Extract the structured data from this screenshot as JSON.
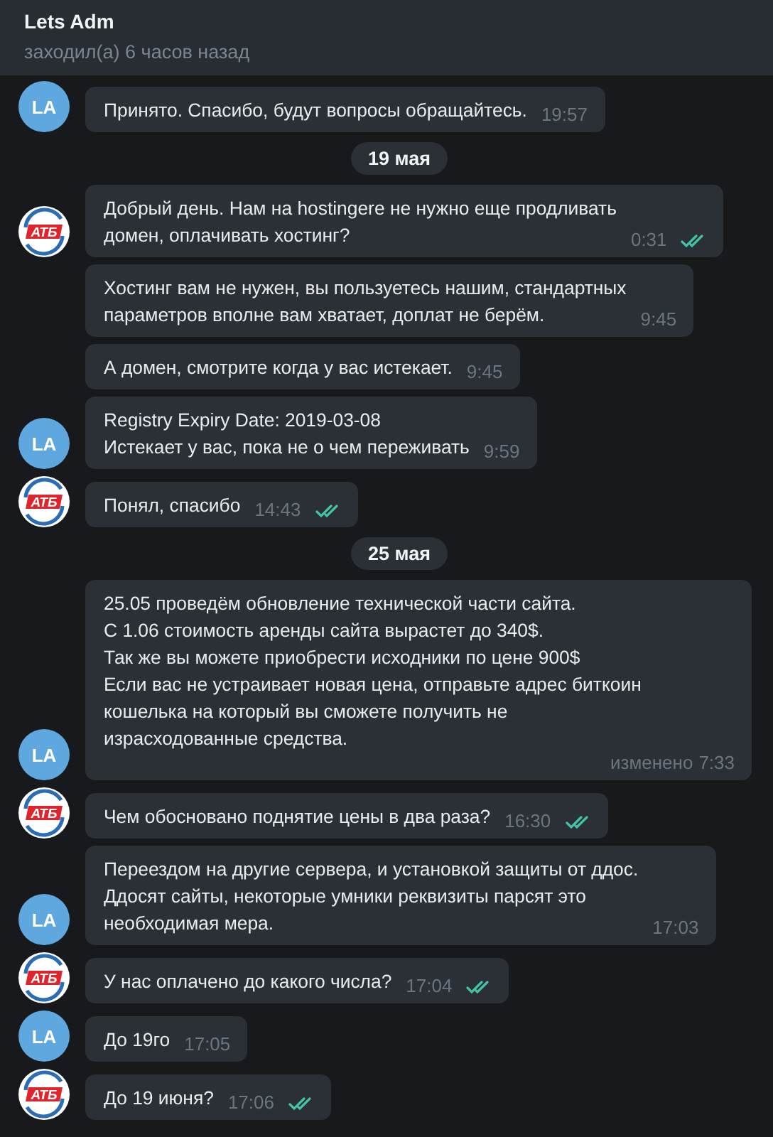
{
  "header": {
    "title": "Lets Adm",
    "status": "заходил(а) 6 часов назад"
  },
  "items": [
    {
      "kind": "group",
      "avatar": {
        "kind": "initials",
        "text": "LA"
      },
      "messages": [
        {
          "text": "Принято. Спасибо, будут вопросы обращайтесь.",
          "time": "19:57",
          "read": false
        }
      ]
    },
    {
      "kind": "date",
      "text": "19 мая"
    },
    {
      "kind": "group",
      "avatar": {
        "kind": "logo",
        "text": "АТБ"
      },
      "messages": [
        {
          "text": "Добрый день. Нам на hostingere не нужно еще продливать\nдомен, оплачивать хостинг?",
          "time": "0:31",
          "read": true
        }
      ]
    },
    {
      "kind": "group",
      "avatar": {
        "kind": "initials",
        "text": "LA"
      },
      "messages": [
        {
          "text": "Хостинг вам не нужен, вы пользуетесь нашим, стандартных\nпараметров вполне вам хватает, доплат не берём.",
          "time": "9:45",
          "read": false
        },
        {
          "text": "А домен, смотрите когда у вас истекает.",
          "time": "9:45",
          "read": false
        },
        {
          "text": "Registry Expiry Date: 2019-03-08\nИстекает у вас, пока не о чем переживать",
          "time": "9:59",
          "read": false
        }
      ]
    },
    {
      "kind": "group",
      "avatar": {
        "kind": "logo",
        "text": "АТБ"
      },
      "messages": [
        {
          "text": "Понял, спасибо",
          "time": "14:43",
          "read": true
        }
      ]
    },
    {
      "kind": "date",
      "text": "25 мая"
    },
    {
      "kind": "group",
      "avatar": {
        "kind": "initials",
        "text": "LA"
      },
      "messages": [
        {
          "text": "25.05 проведём обновление технической части сайта.\nС 1.06 стоимость аренды сайта вырастет до 340$.\nТак же вы можете приобрести исходники по цене 900$\nЕсли вас не устраивает новая цена, отправьте адрес биткоин\nкошелька на который вы сможете получить не\nизрасходованные средства.",
          "edited": "изменено",
          "time": "7:33",
          "read": false
        }
      ]
    },
    {
      "kind": "group",
      "avatar": {
        "kind": "logo",
        "text": "АТБ"
      },
      "messages": [
        {
          "text": "Чем обосновано поднятие цены в два раза?",
          "time": "16:30",
          "read": true
        }
      ]
    },
    {
      "kind": "group",
      "avatar": {
        "kind": "initials",
        "text": "LA"
      },
      "messages": [
        {
          "text": "Переездом на другие сервера, и установкой защиты от ддос.\nДдосят сайты, некоторые умники реквизиты парсят это\nнеобходимая мера.",
          "time": "17:03",
          "read": false
        }
      ]
    },
    {
      "kind": "group",
      "avatar": {
        "kind": "logo",
        "text": "АТБ"
      },
      "messages": [
        {
          "text": "У нас оплачено до какого числа?",
          "time": "17:04",
          "read": true
        }
      ]
    },
    {
      "kind": "group",
      "avatar": {
        "kind": "initials",
        "text": "LA"
      },
      "messages": [
        {
          "text": "До 19го",
          "time": "17:05",
          "read": false
        }
      ]
    },
    {
      "kind": "group",
      "avatar": {
        "kind": "logo",
        "text": "АТБ"
      },
      "messages": [
        {
          "text": "До 19 июня?",
          "time": "17:06",
          "read": true
        }
      ]
    }
  ]
}
